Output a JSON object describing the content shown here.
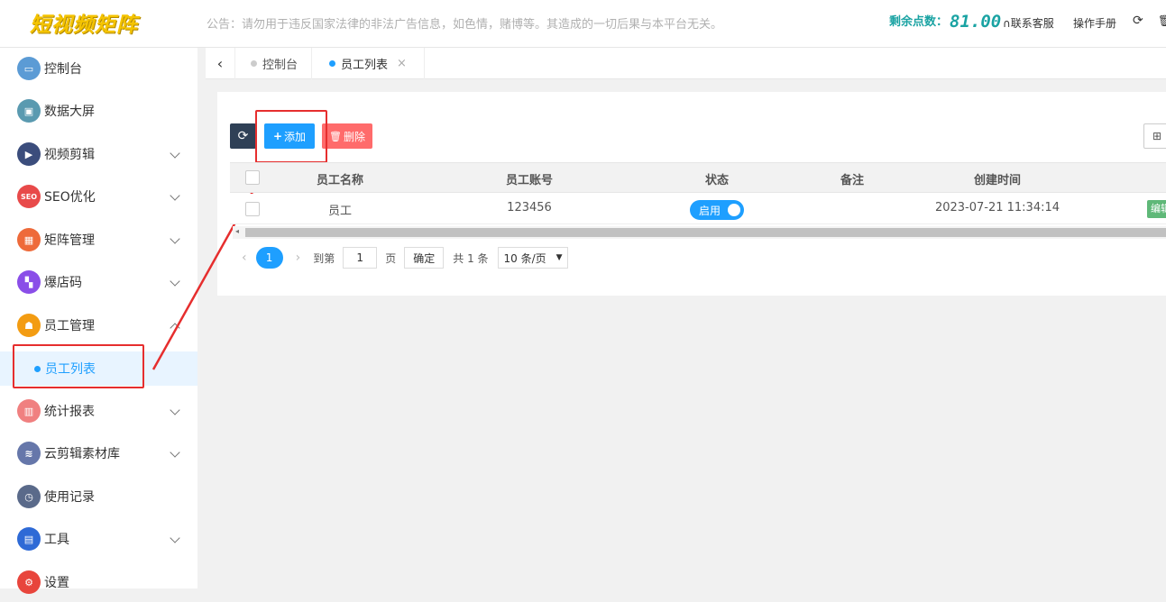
{
  "header": {
    "logo": "短视频矩阵",
    "notice": "公告：请勿用于违反国家法律的非法广告信息，如色情，赌博等。其造成的一切后果与本平台无关。",
    "points_label": "剩余点数：",
    "points_value": "81.00",
    "contact": "联系客服",
    "manual": "操作手册"
  },
  "sidebar": {
    "items": [
      {
        "label": "控制台",
        "icon": "monitor-icon",
        "color": "#5b9bd5"
      },
      {
        "label": "数据大屏",
        "icon": "screen-icon",
        "color": "#5a9ab0"
      },
      {
        "label": "视频剪辑",
        "icon": "video-edit-icon",
        "color": "#3b4d7c"
      },
      {
        "label": "SEO优化",
        "icon": "seo-icon",
        "color": "#e84a4a"
      },
      {
        "label": "矩阵管理",
        "icon": "matrix-icon",
        "color": "#ee6a3a"
      },
      {
        "label": "爆店码",
        "icon": "qr-icon",
        "color": "#8a4ee8"
      },
      {
        "label": "员工管理",
        "icon": "badge-icon",
        "color": "#f39c12"
      },
      {
        "label": "统计报表",
        "icon": "chart-icon",
        "color": "#f08080"
      },
      {
        "label": "云剪辑素材库",
        "icon": "layers-icon",
        "color": "#6677aa"
      },
      {
        "label": "使用记录",
        "icon": "clock-icon",
        "color": "#5a6a8a"
      },
      {
        "label": "工具",
        "icon": "toolbox-icon",
        "color": "#2e6ad6"
      },
      {
        "label": "设置",
        "icon": "gear-icon",
        "color": "#e8453c"
      }
    ],
    "sub_item": "员工列表"
  },
  "tabs": [
    {
      "label": "控制台",
      "dot_color": "#cccccc"
    },
    {
      "label": "员工列表",
      "dot_color": "#1e9fff"
    }
  ],
  "toolbar": {
    "add_label": "添加",
    "delete_label": "删除"
  },
  "table": {
    "headers": [
      "员工名称",
      "员工账号",
      "状态",
      "备注",
      "创建时间"
    ],
    "rows": [
      {
        "name": "员工",
        "account": "123456",
        "status": "启用",
        "remark": "",
        "created": "2023-07-21 11:34:14",
        "action": "编辑"
      }
    ]
  },
  "pagination": {
    "current_page": "1",
    "goto_label": "到第",
    "page_input": "1",
    "page_unit": "页",
    "confirm": "确定",
    "total": "共 1 条",
    "page_size": "10 条/页"
  },
  "colors": {
    "accent": "#1e9fff",
    "danger": "#ff5722",
    "success": "#5fb878",
    "dark": "#2f4056"
  }
}
